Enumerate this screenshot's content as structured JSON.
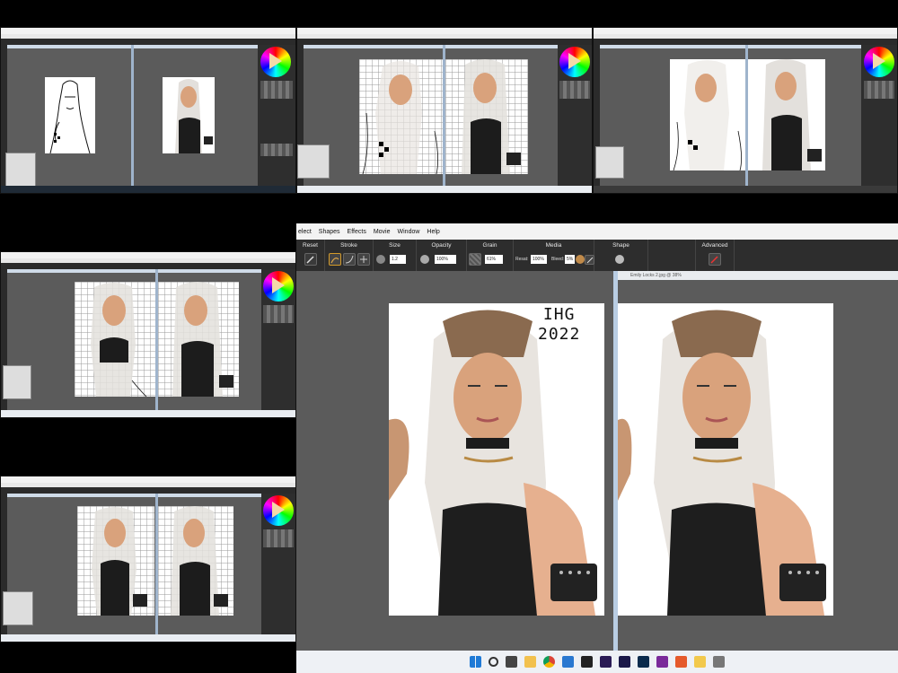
{
  "app": {
    "menu": [
      "elect",
      "Shapes",
      "Effects",
      "Movie",
      "Window",
      "Help"
    ]
  },
  "props": {
    "reset_label": "Reset",
    "stroke_label": "Stroke",
    "size_label": "Size",
    "size_value": "1.2",
    "opacity_label": "Opacity",
    "opacity_value": "100%",
    "grain_label": "Grain",
    "grain_value": "61%",
    "media_label": "Media",
    "media_reset_label": "Resat:",
    "media_reset_value": "100%",
    "bleed_label": "Bleed:",
    "bleed_value": "5%",
    "shape_label": "Shape",
    "advanced_label": "Advanced"
  },
  "document": {
    "right_title": "Emily Locks 2.jpg @ 38%",
    "watermark_line1": "IHG",
    "watermark_line2": "2022"
  },
  "colors": {
    "workspace": "#5b5b5b",
    "propbar": "#2d2d2d",
    "divider": "#b9cde3",
    "taskbar": "#eef1f5"
  },
  "taskbar_icons": [
    "windows-start",
    "search",
    "task-view",
    "files",
    "chrome",
    "store",
    "media",
    "premiere",
    "after-effects",
    "photoshop",
    "onenote",
    "app-orange",
    "app-yellow",
    "app-gray"
  ]
}
